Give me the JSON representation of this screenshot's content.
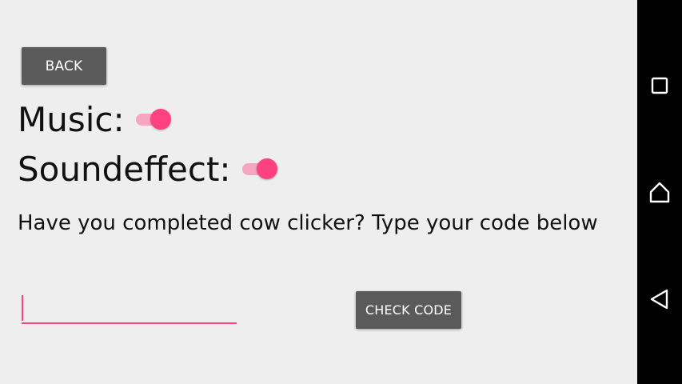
{
  "toolbar": {
    "back_label": "BACK"
  },
  "settings": {
    "music_label": "Music:",
    "music_on": true,
    "soundeffect_label": "Soundeffect:",
    "soundeffect_on": true
  },
  "code": {
    "prompt": "Have you completed cow clicker? Type your code below",
    "input_value": "",
    "check_label": "CHECK CODE"
  },
  "navbar": {
    "icons": [
      "recents-icon",
      "home-icon",
      "back-icon"
    ]
  },
  "colors": {
    "accent": "#ff4081",
    "accent_track": "#f7a6c1",
    "button_bg": "#5a5a5a",
    "background": "#eeeeee",
    "navbar_bg": "#000000"
  }
}
